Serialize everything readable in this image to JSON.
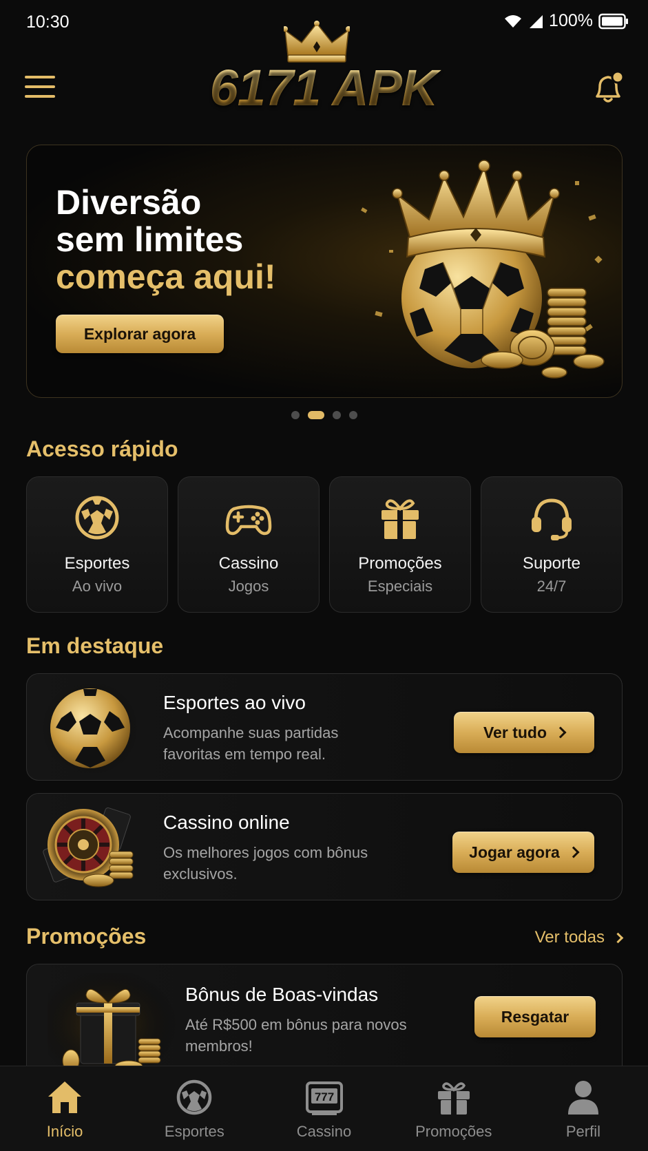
{
  "status_bar": {
    "time": "10:30",
    "battery": "100%"
  },
  "header": {
    "logo_text": "6171 APK",
    "menu_icon": "hamburger-icon",
    "notification_icon": "bell-icon"
  },
  "hero": {
    "line1": "Diversão",
    "line2": "sem limites",
    "line3": "começa aqui!",
    "button": "Explorar agora",
    "slides": 4,
    "active_slide": 2
  },
  "quick_access": {
    "title": "Acesso rápido",
    "items": [
      {
        "label": "Esportes",
        "sub": "Ao vivo",
        "icon": "soccer-ball-icon"
      },
      {
        "label": "Cassino",
        "sub": "Jogos",
        "icon": "gamepad-icon"
      },
      {
        "label": "Promoções",
        "sub": "Especiais",
        "icon": "gift-icon"
      },
      {
        "label": "Suporte",
        "sub": "24/7",
        "icon": "headset-icon"
      }
    ]
  },
  "featured": {
    "title": "Em destaque",
    "cards": [
      {
        "title": "Esportes ao vivo",
        "desc": "Acompanhe suas partidas favoritas em tempo real.",
        "button": "Ver tudo"
      },
      {
        "title": "Cassino online",
        "desc": "Os melhores jogos com bônus exclusivos.",
        "button": "Jogar agora"
      }
    ]
  },
  "promotions": {
    "title": "Promoções",
    "see_all": "Ver todas",
    "card": {
      "title": "Bônus de Boas-vindas",
      "desc": "Até R$500 em bônus para novos membros!",
      "button": "Resgatar"
    }
  },
  "bottom_nav": [
    {
      "label": "Início",
      "icon": "home-icon",
      "active": true
    },
    {
      "label": "Esportes",
      "icon": "soccer-ball-icon",
      "active": false
    },
    {
      "label": "Cassino",
      "icon": "slot-machine-icon",
      "active": false
    },
    {
      "label": "Promoções",
      "icon": "gift-icon",
      "active": false
    },
    {
      "label": "Perfil",
      "icon": "user-icon",
      "active": false
    }
  ],
  "colors": {
    "gold": "#e5bf6a",
    "background": "#0b0b0b",
    "card": "#151515"
  }
}
